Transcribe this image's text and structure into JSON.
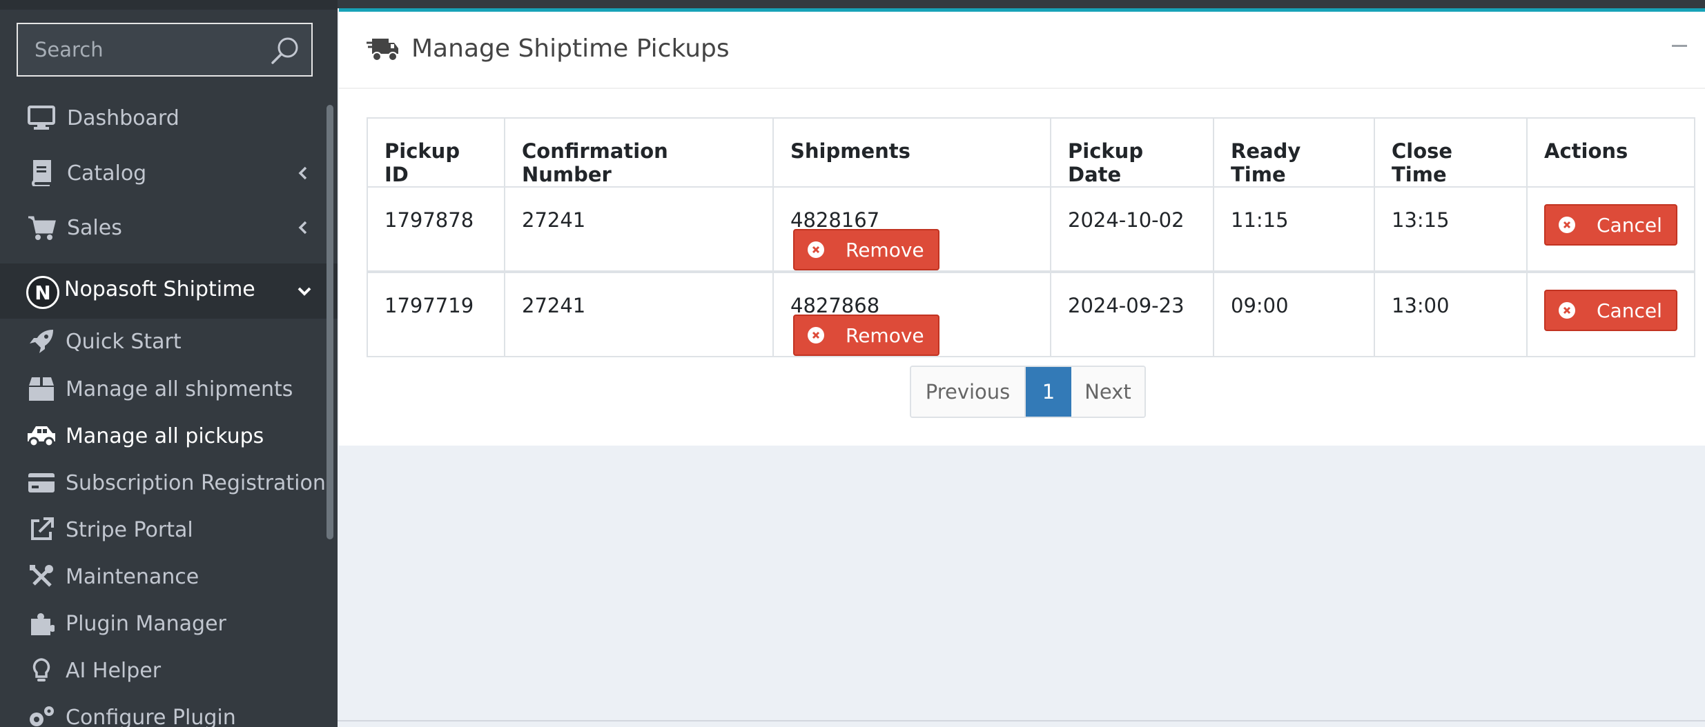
{
  "sidebar": {
    "search_placeholder": "Search",
    "items": [
      {
        "label": "Dashboard",
        "icon": "monitor-icon"
      },
      {
        "label": "Catalog",
        "icon": "book-icon"
      },
      {
        "label": "Sales",
        "icon": "cart-icon"
      }
    ],
    "group": {
      "label": "Nopasoft Shiptime",
      "logo": "N"
    },
    "sub_items": [
      {
        "label": "Quick Start",
        "icon": "rocket-icon"
      },
      {
        "label": "Manage all shipments",
        "icon": "box-icon"
      },
      {
        "label": "Manage all pickups",
        "icon": "truck-icon",
        "active": true
      },
      {
        "label": "Subscription Registration",
        "icon": "credit-card-icon"
      },
      {
        "label": "Stripe Portal",
        "icon": "external-link-icon"
      },
      {
        "label": "Maintenance",
        "icon": "tools-icon"
      },
      {
        "label": "Plugin Manager",
        "icon": "puzzle-icon"
      },
      {
        "label": "AI Helper",
        "icon": "lightbulb-icon"
      },
      {
        "label": "Configure Plugin",
        "icon": "gears-icon"
      }
    ]
  },
  "card": {
    "title": "Manage Shiptime Pickups",
    "columns": [
      "Pickup ID",
      "Confirmation Number",
      "Shipments",
      "Pickup Date",
      "Ready Time",
      "Close Time",
      "Actions"
    ],
    "rows": [
      {
        "pickup_id": "1797878",
        "confirmation": "27241",
        "shipment": "4828167",
        "remove": "Remove",
        "date": "2024-10-02",
        "ready": "11:15",
        "close": "13:15",
        "cancel": "Cancel"
      },
      {
        "pickup_id": "1797719",
        "confirmation": "27241",
        "shipment": "4827868",
        "remove": "Remove",
        "date": "2024-09-23",
        "ready": "09:00",
        "close": "13:00",
        "cancel": "Cancel"
      }
    ]
  },
  "pagination": {
    "previous": "Previous",
    "current": "1",
    "next": "Next"
  },
  "colors": {
    "accent": "#17a2b8",
    "danger": "#dd4b39",
    "primary": "#337ab7",
    "sidebar": "#343a40"
  }
}
